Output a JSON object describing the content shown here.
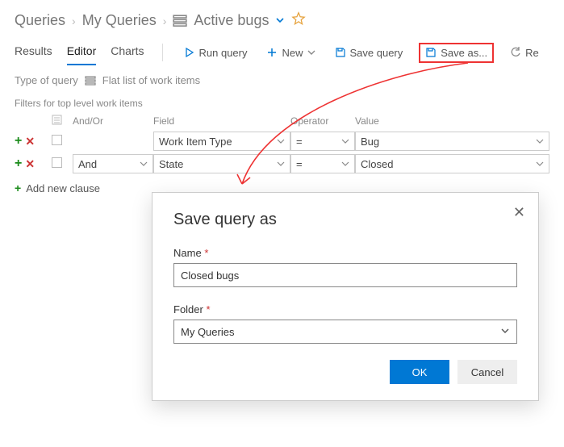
{
  "breadcrumb": {
    "root": "Queries",
    "mid": "My Queries",
    "title": "Active bugs"
  },
  "tabs": {
    "results": "Results",
    "editor": "Editor",
    "charts": "Charts"
  },
  "toolbar": {
    "run": "Run query",
    "new": "New",
    "save": "Save query",
    "saveas": "Save as...",
    "refresh": "Re"
  },
  "qtype": {
    "label": "Type of query",
    "value": "Flat list of work items"
  },
  "filters": {
    "heading": "Filters for top level work items",
    "cols": {
      "andor": "And/Or",
      "field": "Field",
      "operator": "Operator",
      "value": "Value"
    },
    "rows": [
      {
        "andor": "",
        "field": "Work Item Type",
        "op": "=",
        "value": "Bug"
      },
      {
        "andor": "And",
        "field": "State",
        "op": "=",
        "value": "Closed"
      }
    ],
    "addnew": "Add new clause"
  },
  "dialog": {
    "title": "Save query as",
    "name_label": "Name",
    "name_value": "Closed bugs",
    "folder_label": "Folder",
    "folder_value": "My Queries",
    "ok": "OK",
    "cancel": "Cancel"
  }
}
